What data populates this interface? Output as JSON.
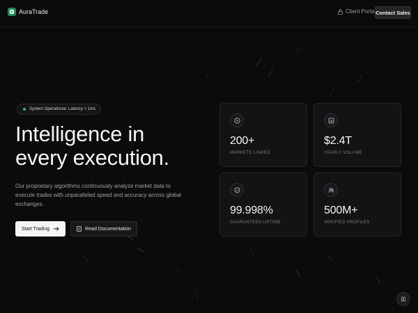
{
  "header": {
    "brand": "AuraTrade",
    "client_portal": "Client Portal",
    "contact_sales": "Contact Sales"
  },
  "hero": {
    "status": "System Operational: Latency < 1ms",
    "headline_line1": "Intelligence in",
    "headline_line2": "every execution.",
    "description": "Our proprietary algorithms continuously analyze market data to execute trades with unparalleled speed and accuracy across global exchanges.",
    "primary_button": "Start Trading",
    "secondary_button": "Read Documentation"
  },
  "stats": [
    {
      "value": "200+",
      "label": "MARKETS LINKED",
      "icon": "globe-icon"
    },
    {
      "value": "$2.4T",
      "label": "YEARLY VOLUME",
      "icon": "chart-icon"
    },
    {
      "value": "99.998%",
      "label": "GUARANTEED UPTIME",
      "icon": "shield-icon"
    },
    {
      "value": "500M+",
      "label": "VERIFIED PROFILES",
      "icon": "users-icon"
    }
  ],
  "colors": {
    "background": "#0b0b0c",
    "accent": "#27c47d",
    "brand": "#1f8a5b"
  }
}
